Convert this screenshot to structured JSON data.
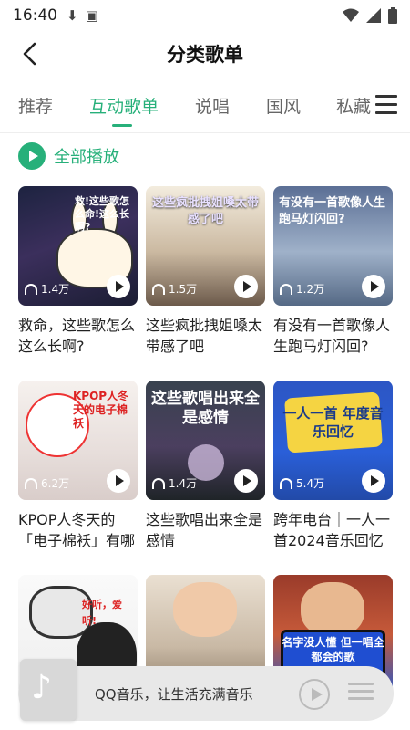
{
  "status_bar": {
    "time": "16:40"
  },
  "header": {
    "title": "分类歌单"
  },
  "tabs": [
    {
      "label": "推荐"
    },
    {
      "label": "互动歌单"
    },
    {
      "label": "说唱"
    },
    {
      "label": "国风"
    },
    {
      "label": "私藏"
    }
  ],
  "play_all": {
    "label": "全部播放"
  },
  "playlists": [
    {
      "title": "救命，这些歌怎么这么长啊?",
      "plays": "1.4万",
      "cover_text": "救!这些歌怎么命!这么长啊?"
    },
    {
      "title": "这些疯批拽姐嗓太带感了吧",
      "plays": "1.5万",
      "cover_text": "这些疯批拽姐嗓太带感了吧"
    },
    {
      "title": "有没有一首歌像人生跑马灯闪回?",
      "plays": "1.2万",
      "cover_text": "有没有一首歌像人生跑马灯闪回?"
    },
    {
      "title": "KPOP人冬天的「电子棉袄」有哪",
      "plays": "6.2万",
      "cover_text": "KPOP人冬天的电子棉袄"
    },
    {
      "title": "这些歌唱出来全是感情",
      "plays": "1.4万",
      "cover_text": "这些歌唱出来全是感情"
    },
    {
      "title": "跨年电台｜一人一首2024音乐回忆",
      "plays": "5.4万",
      "cover_text": "一人一首 年度音乐回忆"
    },
    {
      "title": "",
      "plays": "",
      "cover_text": "好听，爱听!"
    },
    {
      "title": "",
      "plays": "",
      "cover_text": ""
    },
    {
      "title": "",
      "plays": "",
      "cover_text": "名字没人懂 但一唱全都会的歌"
    }
  ],
  "mini_player": {
    "slogan": "QQ音乐，让生活充满音乐"
  },
  "colors": {
    "accent": "#27b07a"
  }
}
